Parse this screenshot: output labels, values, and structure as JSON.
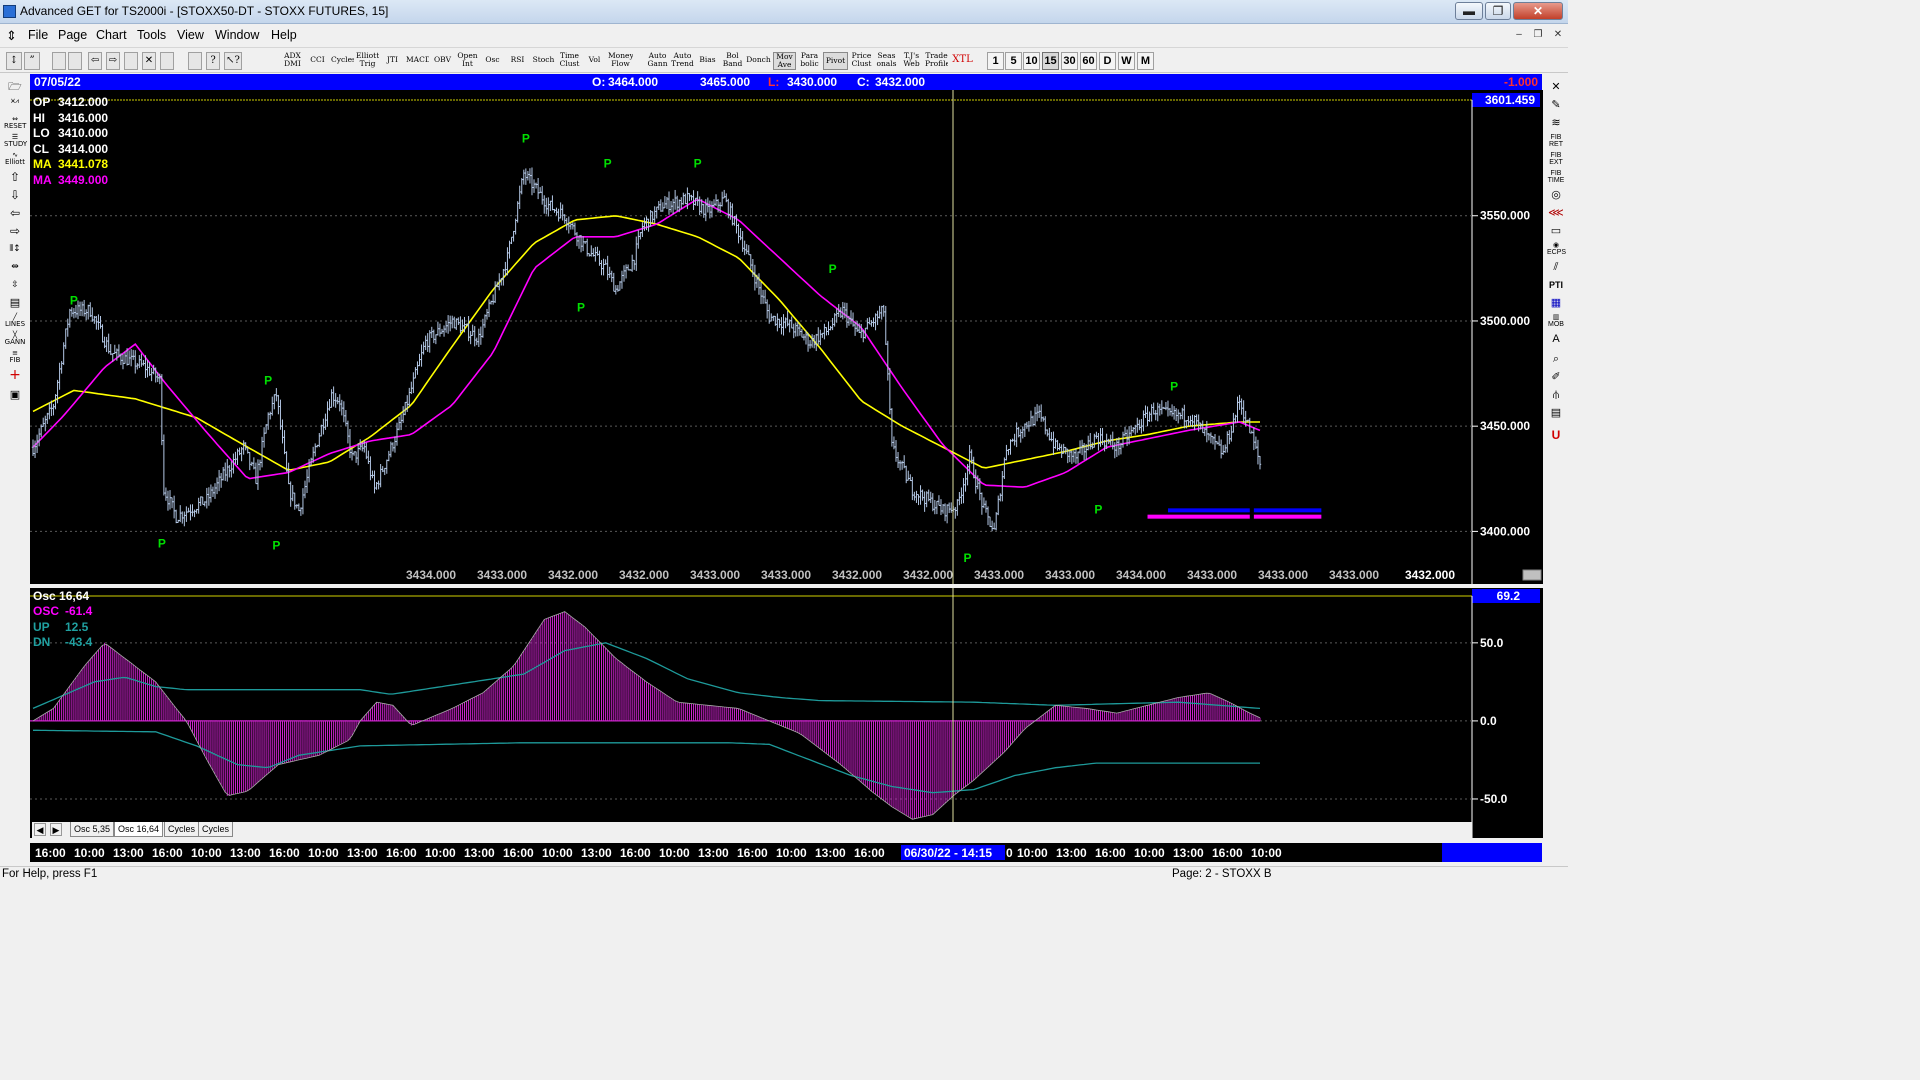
{
  "window": {
    "title": "Advanced GET for TS2000i - [STOXX50-DT - STOXX FUTURES, 15]",
    "min_label": "▬",
    "restore_label": "❐",
    "close_label": "✕"
  },
  "menu": [
    "File",
    "Page",
    "Chart",
    "Tools",
    "View",
    "Window",
    "Help"
  ],
  "toolbar": {
    "studies": [
      {
        "label": "ADX DMI"
      },
      {
        "label": "CCI"
      },
      {
        "label": "Cycles"
      },
      {
        "label": "Elliott Trig"
      },
      {
        "label": "JTI"
      },
      {
        "label": "MACD"
      },
      {
        "label": "OBV"
      },
      {
        "label": "Open Int"
      },
      {
        "label": "Osc"
      },
      {
        "label": "RSI"
      },
      {
        "label": "Stoch"
      },
      {
        "label": "Time Clust"
      },
      {
        "label": "Vol"
      },
      {
        "label": "Money Flow"
      },
      {
        "label": "Auto Gann"
      },
      {
        "label": "Auto Trend"
      },
      {
        "label": "Bias"
      },
      {
        "label": "Bol Band"
      },
      {
        "label": "Donch"
      },
      {
        "label": "Mov Ave"
      },
      {
        "label": "Para bolic"
      },
      {
        "label": "Pivot"
      },
      {
        "label": "Price Clust"
      },
      {
        "label": "Seas onals"
      },
      {
        "label": "T.J's Web"
      },
      {
        "label": "Trade Profile"
      },
      {
        "label": "XTL"
      }
    ],
    "timeframes": [
      "1",
      "5",
      "10",
      "15",
      "30",
      "60",
      "D",
      "W",
      "M"
    ],
    "selected_timeframe": "15"
  },
  "price_panel": {
    "date": "07/05/22",
    "open_label": "O:",
    "open": "3464.000",
    "high": "3465.000",
    "low_label": "L:",
    "low": "3430.000",
    "close_label": "C:",
    "close": "3432.000",
    "change": "-1.000",
    "top_price": "3601.459",
    "info": [
      {
        "label": "OP",
        "value": "3412.000",
        "color": "#ffffff"
      },
      {
        "label": "HI",
        "value": "3416.000",
        "color": "#ffffff"
      },
      {
        "label": "LO",
        "value": "3410.000",
        "color": "#ffffff"
      },
      {
        "label": "CL",
        "value": "3414.000",
        "color": "#ffffff"
      },
      {
        "label": "MA",
        "value": "3441.078",
        "color": "#ffff00"
      },
      {
        "label": "MA",
        "value": "3449.000",
        "color": "#ff00ff"
      }
    ],
    "bottom_values": [
      "3434.000",
      "3433.000",
      "3432.000",
      "3432.000",
      "3433.000",
      "3433.000",
      "3432.000",
      "3432.000",
      "3433.000",
      "3433.000",
      "3434.000",
      "3433.000",
      "3433.000",
      "3433.000"
    ],
    "last_value": "3432.000"
  },
  "osc_panel": {
    "title": "Osc 16,64",
    "top_value": "69.2",
    "info": [
      {
        "label": "OSC",
        "value": "-61.4",
        "color": "#ff00ff"
      },
      {
        "label": "UP",
        "value": "12.5",
        "color": "#20a0a0"
      },
      {
        "label": "DN",
        "value": "-43.4",
        "color": "#20a0a0"
      }
    ]
  },
  "tabs": [
    "Osc 5,35",
    "Osc 16,64",
    "Cycles",
    "Cycles"
  ],
  "time_axis": {
    "labels": [
      "16:00",
      "10:00",
      "13:00",
      "16:00",
      "10:00",
      "13:00",
      "16:00",
      "10:00",
      "13:00",
      "16:00",
      "10:00",
      "13:00",
      "16:00",
      "10:00",
      "13:00",
      "16:00",
      "10:00",
      "13:00",
      "16:00",
      "10:00",
      "13:00",
      "16:00"
    ],
    "cursor_label": "06/30/22 - 14:15",
    "labels_after": [
      "0",
      "10:00",
      "13:00",
      "16:00",
      "10:00",
      "13:00",
      "16:00",
      "10:00"
    ]
  },
  "status": {
    "help": "For Help, press F1",
    "page": "Page: 2 - STOXX B"
  },
  "colors": {
    "background": "#000000",
    "price_bars": "#b4c8e6",
    "ma_fast": "#ffff00",
    "ma_slow": "#ff00ff",
    "pivot": "#00e000",
    "osc_hist": "#cc22cc",
    "bands": "#1e9a9a",
    "header_bar": "#0000ff"
  },
  "chart_data": [
    {
      "type": "bar",
      "title": "STOXX50-DT - STOXX FUTURES, 15",
      "ylim": [
        3375,
        3605
      ],
      "yticks": [
        3400,
        3450,
        3500,
        3550
      ],
      "ytick_labels": [
        "3400.000",
        "3450.000",
        "3500.000",
        "3550.000"
      ],
      "anchors": [
        [
          0,
          3440
        ],
        [
          10,
          3460
        ],
        [
          18,
          3505
        ],
        [
          28,
          3505
        ],
        [
          38,
          3485
        ],
        [
          55,
          3478
        ],
        [
          62,
          3472
        ],
        [
          64,
          3420
        ],
        [
          70,
          3407
        ],
        [
          85,
          3415
        ],
        [
          97,
          3432
        ],
        [
          103,
          3440
        ],
        [
          109,
          3425
        ],
        [
          115,
          3455
        ],
        [
          119,
          3465
        ],
        [
          125,
          3420
        ],
        [
          130,
          3410
        ],
        [
          138,
          3440
        ],
        [
          146,
          3465
        ],
        [
          150,
          3462
        ],
        [
          156,
          3435
        ],
        [
          162,
          3440
        ],
        [
          167,
          3420
        ],
        [
          172,
          3432
        ],
        [
          180,
          3452
        ],
        [
          192,
          3490
        ],
        [
          205,
          3500
        ],
        [
          218,
          3492
        ],
        [
          232,
          3530
        ],
        [
          240,
          3570
        ],
        [
          252,
          3555
        ],
        [
          260,
          3550
        ],
        [
          270,
          3535
        ],
        [
          280,
          3525
        ],
        [
          285,
          3515
        ],
        [
          294,
          3530
        ],
        [
          298,
          3545
        ],
        [
          308,
          3555
        ],
        [
          320,
          3558
        ],
        [
          330,
          3552
        ],
        [
          338,
          3558
        ],
        [
          346,
          3540
        ],
        [
          360,
          3502
        ],
        [
          370,
          3498
        ],
        [
          380,
          3490
        ],
        [
          388,
          3495
        ],
        [
          396,
          3505
        ],
        [
          404,
          3493
        ],
        [
          416,
          3505
        ],
        [
          420,
          3440
        ],
        [
          430,
          3420
        ],
        [
          445,
          3410
        ],
        [
          452,
          3412
        ],
        [
          458,
          3435
        ],
        [
          465,
          3410
        ],
        [
          470,
          3400
        ],
        [
          476,
          3440
        ],
        [
          484,
          3450
        ],
        [
          492,
          3455
        ],
        [
          500,
          3440
        ],
        [
          510,
          3435
        ],
        [
          520,
          3445
        ],
        [
          530,
          3440
        ],
        [
          540,
          3450
        ],
        [
          548,
          3458
        ],
        [
          556,
          3455
        ],
        [
          566,
          3455
        ],
        [
          574,
          3445
        ],
        [
          582,
          3437
        ],
        [
          590,
          3462
        ],
        [
          596,
          3445
        ],
        [
          600,
          3432
        ]
      ],
      "pivots": {
        "high": [
          [
            20,
            3505
          ],
          [
            115,
            3467
          ],
          [
            241,
            3582
          ],
          [
            281,
            3570
          ],
          [
            325,
            3570
          ],
          [
            391,
            3520
          ],
          [
            558,
            3464
          ]
        ],
        "low": [
          [
            63,
            3400
          ],
          [
            119,
            3399
          ],
          [
            268,
            3512
          ],
          [
            457,
            3393
          ],
          [
            521,
            3416
          ]
        ]
      },
      "ma_fast_anchors": [
        [
          0,
          3457
        ],
        [
          20,
          3467
        ],
        [
          50,
          3463
        ],
        [
          80,
          3454
        ],
        [
          105,
          3440
        ],
        [
          125,
          3429
        ],
        [
          145,
          3433
        ],
        [
          165,
          3445
        ],
        [
          185,
          3460
        ],
        [
          205,
          3488
        ],
        [
          225,
          3515
        ],
        [
          245,
          3537
        ],
        [
          265,
          3548
        ],
        [
          285,
          3550
        ],
        [
          305,
          3546
        ],
        [
          325,
          3540
        ],
        [
          345,
          3530
        ],
        [
          365,
          3510
        ],
        [
          385,
          3487
        ],
        [
          405,
          3462
        ],
        [
          425,
          3450
        ],
        [
          445,
          3440
        ],
        [
          465,
          3430
        ],
        [
          485,
          3434
        ],
        [
          505,
          3438
        ],
        [
          525,
          3443
        ],
        [
          545,
          3446
        ],
        [
          565,
          3450
        ],
        [
          590,
          3452
        ],
        [
          600,
          3452
        ]
      ],
      "ma_slow_anchors": [
        [
          0,
          3440
        ],
        [
          15,
          3455
        ],
        [
          35,
          3478
        ],
        [
          50,
          3489
        ],
        [
          65,
          3470
        ],
        [
          85,
          3447
        ],
        [
          105,
          3425
        ],
        [
          125,
          3428
        ],
        [
          145,
          3437
        ],
        [
          165,
          3443
        ],
        [
          185,
          3446
        ],
        [
          205,
          3460
        ],
        [
          225,
          3485
        ],
        [
          245,
          3525
        ],
        [
          265,
          3540
        ],
        [
          285,
          3540
        ],
        [
          305,
          3546
        ],
        [
          325,
          3558
        ],
        [
          345,
          3548
        ],
        [
          365,
          3530
        ],
        [
          385,
          3512
        ],
        [
          405,
          3497
        ],
        [
          425,
          3468
        ],
        [
          445,
          3441
        ],
        [
          465,
          3422
        ],
        [
          485,
          3421
        ],
        [
          505,
          3428
        ],
        [
          525,
          3440
        ],
        [
          545,
          3444
        ],
        [
          565,
          3448
        ],
        [
          590,
          3452
        ],
        [
          600,
          3448
        ]
      ],
      "projection_bands": [
        {
          "from_bar": 545,
          "to_bar": 595,
          "level": 3407,
          "color": "#ff00ff"
        },
        {
          "from_bar": 555,
          "to_bar": 595,
          "level": 3410,
          "color": "#0000ff"
        }
      ]
    },
    {
      "type": "bar",
      "title": "Osc 16,64",
      "ylim": [
        -75,
        80
      ],
      "yticks": [
        50,
        0,
        -50
      ],
      "ytick_labels": [
        "50.0",
        "0.0",
        "-50.0"
      ],
      "anchors": [
        [
          0,
          0
        ],
        [
          10,
          8
        ],
        [
          25,
          35
        ],
        [
          35,
          50
        ],
        [
          45,
          40
        ],
        [
          60,
          25
        ],
        [
          70,
          8
        ],
        [
          75,
          0
        ],
        [
          85,
          -25
        ],
        [
          95,
          -48
        ],
        [
          105,
          -45
        ],
        [
          120,
          -28
        ],
        [
          140,
          -22
        ],
        [
          155,
          -12
        ],
        [
          160,
          0
        ],
        [
          168,
          12
        ],
        [
          176,
          10
        ],
        [
          185,
          -3
        ],
        [
          205,
          8
        ],
        [
          220,
          18
        ],
        [
          235,
          35
        ],
        [
          250,
          65
        ],
        [
          260,
          70
        ],
        [
          270,
          60
        ],
        [
          285,
          40
        ],
        [
          300,
          25
        ],
        [
          315,
          12
        ],
        [
          330,
          10
        ],
        [
          345,
          8
        ],
        [
          360,
          0
        ],
        [
          375,
          -8
        ],
        [
          395,
          -28
        ],
        [
          410,
          -45
        ],
        [
          420,
          -55
        ],
        [
          430,
          -63
        ],
        [
          440,
          -60
        ],
        [
          450,
          -48
        ],
        [
          460,
          -38
        ],
        [
          475,
          -20
        ],
        [
          485,
          -5
        ],
        [
          490,
          0
        ],
        [
          500,
          10
        ],
        [
          515,
          8
        ],
        [
          530,
          5
        ],
        [
          545,
          10
        ],
        [
          560,
          15
        ],
        [
          575,
          18
        ],
        [
          585,
          12
        ],
        [
          595,
          5
        ],
        [
          600,
          2
        ]
      ],
      "up_band_anchors": [
        [
          0,
          8
        ],
        [
          30,
          25
        ],
        [
          45,
          28
        ],
        [
          60,
          22
        ],
        [
          75,
          20
        ],
        [
          105,
          20
        ],
        [
          160,
          20
        ],
        [
          175,
          17
        ],
        [
          240,
          30
        ],
        [
          260,
          45
        ],
        [
          280,
          50
        ],
        [
          300,
          40
        ],
        [
          320,
          27
        ],
        [
          345,
          18
        ],
        [
          365,
          15
        ],
        [
          385,
          13
        ],
        [
          460,
          12
        ],
        [
          500,
          10
        ],
        [
          560,
          12
        ],
        [
          600,
          8
        ]
      ],
      "dn_band_anchors": [
        [
          0,
          -6
        ],
        [
          60,
          -7
        ],
        [
          80,
          -16
        ],
        [
          100,
          -28
        ],
        [
          115,
          -30
        ],
        [
          130,
          -22
        ],
        [
          160,
          -16
        ],
        [
          240,
          -14
        ],
        [
          340,
          -14
        ],
        [
          360,
          -15
        ],
        [
          380,
          -25
        ],
        [
          400,
          -35
        ],
        [
          420,
          -42
        ],
        [
          440,
          -46
        ],
        [
          460,
          -44
        ],
        [
          480,
          -35
        ],
        [
          500,
          -30
        ],
        [
          520,
          -27
        ],
        [
          560,
          -27
        ],
        [
          600,
          -27
        ]
      ]
    }
  ]
}
